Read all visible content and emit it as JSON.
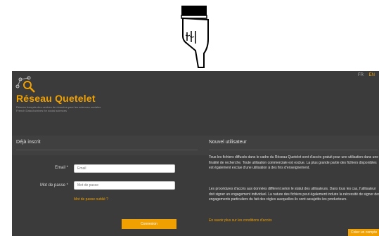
{
  "pointer": {
    "icon": "hand-pointer-icon"
  },
  "header": {
    "languages": [
      {
        "code": "FR",
        "active": false
      },
      {
        "code": "EN",
        "active": true
      }
    ],
    "brand": "Réseau Quetelet",
    "tagline_fr": "Réseau français des centres de données pour les sciences sociales",
    "tagline_en": "French Data Archives for social sciences",
    "logo_icon": "magnifier-network-icon"
  },
  "login": {
    "title": "Déjà inscrit",
    "email_label": "Email *",
    "email_placeholder": "Email",
    "password_label": "Mot de passe *",
    "password_placeholder": "Mot de passe",
    "forgot_link": "Mot de passe oublié ?",
    "submit_label": "Connexion"
  },
  "register": {
    "title": "Nouvel utilisateur",
    "paragraph1": "Tous les fichiers diffusés dans le cadre du Réseau Quetelet sont d'accès gratuit pour une utilisation dans une finalité de recherche. Toute utilisation commerciale est exclue. La plus grande partie des fichiers disponibles est également exclue d'une utilisation à des fins d'enseignement.",
    "paragraph2": "Les procédures d'accès aux données diffèrent selon le statut des utilisateurs. Dans tous les cas, l'utilisateur doit signer un engagement individuel. La nature des fichiers peut également induire la nécessité de signer des engagements particuliers du fait des règles auxquelles ils sont assujettis les producteurs.",
    "more_link": "En savoir plus sur les conditions d'accès",
    "create_button": "Créer un compte"
  },
  "colors": {
    "accent": "#f0a000",
    "background": "#3b3b3b"
  }
}
